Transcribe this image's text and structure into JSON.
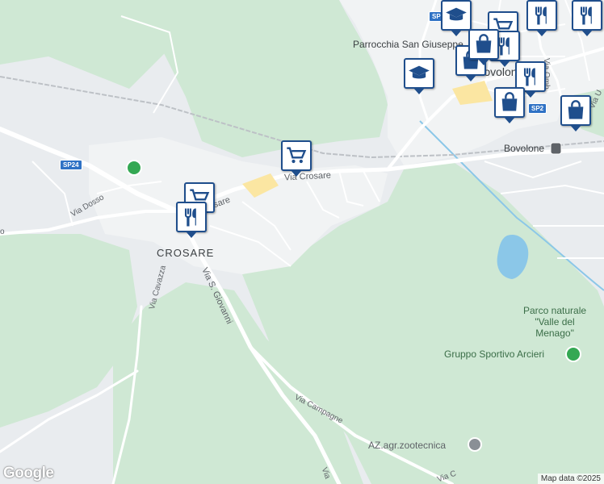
{
  "labels": {
    "parish": "Parrocchia San Giuseppe",
    "town": "Bovolone",
    "station": "Bovolone",
    "village": "CROSARE",
    "via_crosare_1": "Via Crosare",
    "via_crosare_2": "sare",
    "via_dosso": "Via Dosso",
    "via_cavazza": "Via Cavazza",
    "via_s_giovanni": "Via S. Giovanni",
    "via_campagne": "Via Campagne",
    "via_omb": "Via Omb",
    "via_u": "Via U",
    "via_c": "Via C",
    "via_v": "Via",
    "park": "Parco naturale\n\"Valle del\nMenago\"",
    "sports": "Gruppo Sportivo Arcieri",
    "farm": "AZ.agr.zootecnica",
    "left_edge": "o"
  },
  "shields": {
    "sp24": "SP24",
    "sp2_top": "SP2",
    "sp2_mid": "SP2"
  },
  "markers": [
    {
      "name": "marker-shopping-cart-crosare",
      "icon": "shopping-cart-icon"
    },
    {
      "name": "marker-shopping-cart-crosare-2",
      "icon": "shopping-cart-icon"
    },
    {
      "name": "marker-restaurant-crosare",
      "icon": "restaurant-icon"
    },
    {
      "name": "marker-school-top",
      "icon": "school-icon"
    },
    {
      "name": "marker-school-mid",
      "icon": "school-icon"
    },
    {
      "name": "marker-shopping-cart-top",
      "icon": "shopping-cart-icon"
    },
    {
      "name": "marker-restaurant-top",
      "icon": "restaurant-icon"
    },
    {
      "name": "marker-restaurant-top-2",
      "icon": "restaurant-icon"
    },
    {
      "name": "marker-shopping-bag-1",
      "icon": "shopping-bag-icon"
    },
    {
      "name": "marker-shopping-bag-2",
      "icon": "shopping-bag-icon"
    },
    {
      "name": "marker-restaurant-mid",
      "icon": "restaurant-icon"
    },
    {
      "name": "marker-shopping-bag-3",
      "icon": "shopping-bag-icon"
    },
    {
      "name": "marker-shopping-bag-4",
      "icon": "shopping-bag-icon"
    },
    {
      "name": "marker-restaurant-right",
      "icon": "restaurant-icon"
    }
  ],
  "attribution": {
    "logo": "Google",
    "map_data": "Map data ©2025"
  },
  "colors": {
    "land": "#e9ecef",
    "green": "#cfe8d4",
    "water": "#8bc7e8",
    "road": "#ffffff",
    "marker_border": "#1f4e8c",
    "poi_green": "#34a853"
  }
}
